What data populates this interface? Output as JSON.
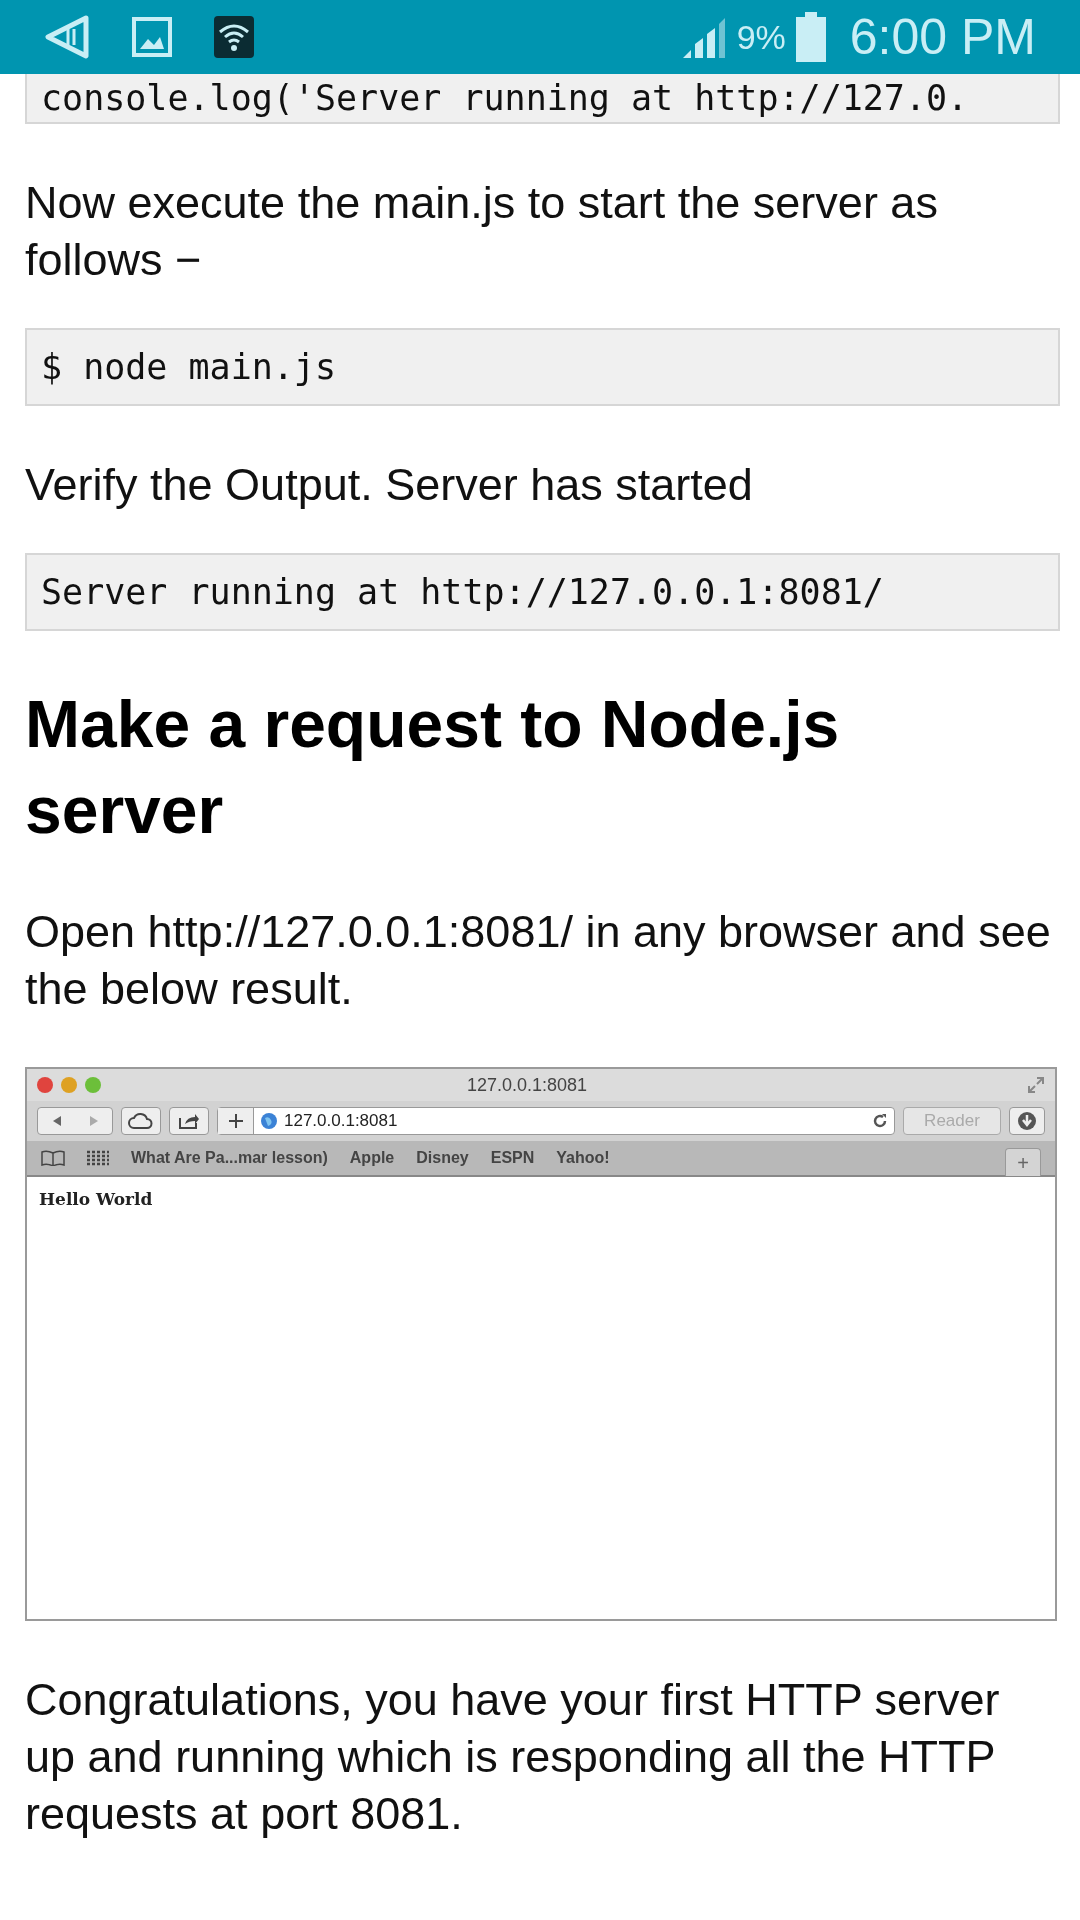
{
  "status_bar": {
    "battery": "9%",
    "time": "6:00 PM"
  },
  "article": [
    {
      "kind": "code",
      "text": "console.log('Server running at http://127.0."
    },
    {
      "kind": "paragraph",
      "text": "Now execute the main.js to start the server as follows −"
    },
    {
      "kind": "code",
      "text": "$ node main.js"
    },
    {
      "kind": "paragraph",
      "text": "Verify the Output. Server has started"
    },
    {
      "kind": "code",
      "text": "Server running at http://127.0.0.1:8081/"
    },
    {
      "kind": "heading",
      "text": "Make a request to Node.js server"
    },
    {
      "kind": "paragraph",
      "text": "Open http://127.0.0.1:8081/ in any browser and see the below result."
    },
    {
      "kind": "browser",
      "window_title": "127.0.0.1:8081",
      "address": "127.0.0.1:8081",
      "reader_label": "Reader",
      "bookmarks": [
        "What Are Pa...mar lesson)",
        "Apple",
        "Disney",
        "ESPN",
        "Yahoo!"
      ],
      "new_tab": "+",
      "page_text": "Hello World"
    },
    {
      "kind": "paragraph",
      "text": "Congratulations, you have your first HTTP server up and running which is responding all the HTTP requests at port 8081."
    }
  ]
}
